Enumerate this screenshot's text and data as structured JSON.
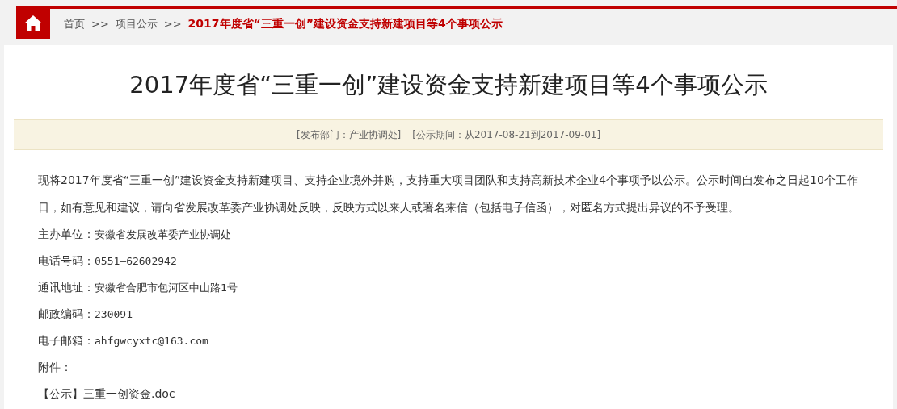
{
  "breadcrumb": [
    {
      "label": "首页",
      "kind": "link"
    },
    {
      "label": ">>",
      "kind": "separator"
    },
    {
      "label": "项目公示",
      "kind": "link"
    },
    {
      "label": ">>",
      "kind": "separator"
    },
    {
      "label": "2017年度省“三重一创”建设资金支持新建项目等4个事项公示",
      "kind": "current"
    }
  ],
  "article": {
    "title": "2017年度省“三重一创”建设资金支持新建项目等4个事项公示",
    "meta": [
      "[发布部门：产业协调处]",
      "[公示期间：从2017-08-21到2017-09-01]"
    ],
    "paragraph": "现将2017年度省“三重一创”建设资金支持新建项目、支持企业境外并购，支持重大项目团队和支持高新技术企业4个事项予以公示。公示时间自发布之日起10个工作日，如有意见和建议，请向省发展改革委产业协调处反映，反映方式以来人或署名来信（包括电子信函），对匿名方式提出异议的不予受理。",
    "fields": [
      {
        "label": "主办单位：",
        "value": "安徽省发展改革委产业协调处"
      },
      {
        "label": "电话号码：",
        "value": "0551—62602942"
      },
      {
        "label": "通讯地址：",
        "value": "安徽省合肥市包河区中山路1号"
      },
      {
        "label": "邮政编码：",
        "value": "230091"
      },
      {
        "label": "电子邮箱：",
        "value": "ahfgwcyxtc@163.com"
      },
      {
        "label": "附件："
      }
    ],
    "attachment": "【公示】三重一创资金.doc"
  }
}
